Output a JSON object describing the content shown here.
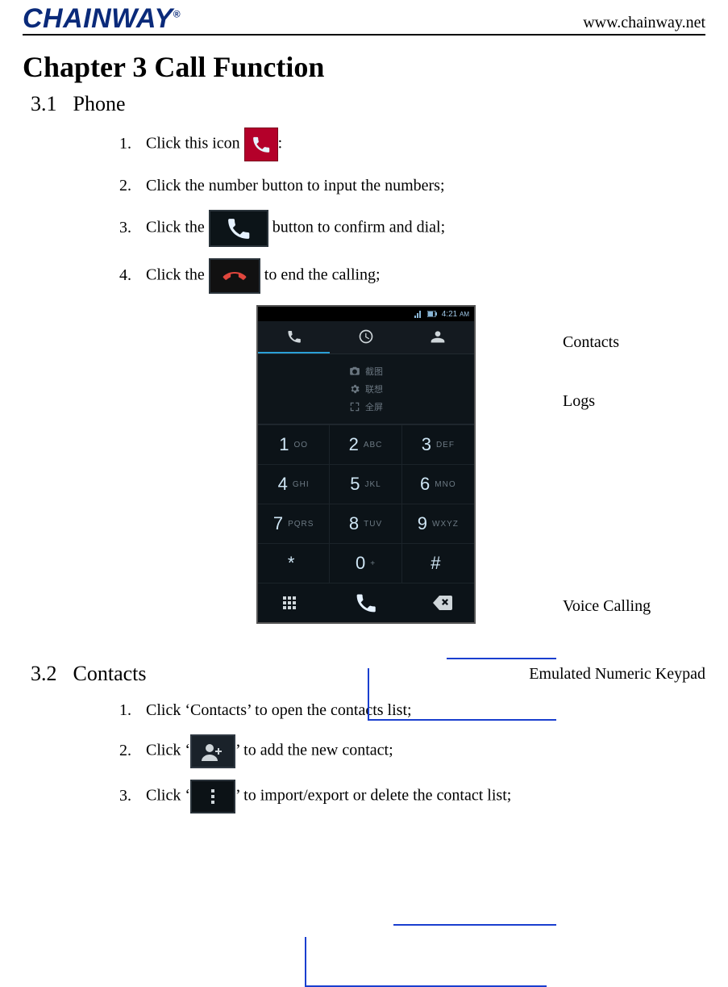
{
  "brand": "CHAINWAY",
  "brand_reg": "®",
  "url": "www.chainway.net",
  "chapter_title": "Chapter 3 Call Function",
  "section31": {
    "num": "3.1",
    "title": "Phone"
  },
  "section32": {
    "num": "3.2",
    "title": "Contacts"
  },
  "s31": {
    "i1a": "1.",
    "i1b": "Click this icon ",
    "i1c": ":",
    "i2a": "2.",
    "i2b": "Click the number button to input the numbers;",
    "i3a": "3.",
    "i3b_pre": "Click the ",
    "i3b_post": " button to confirm and dial;",
    "i4a": "4.",
    "i4b_pre": "Click the ",
    "i4b_post": " to end the calling;"
  },
  "s32": {
    "i1a": "1.",
    "i1b": "Click ‘Contacts’ to open the contacts list;",
    "i2a": "2.",
    "i2b_pre": "Click ‘",
    "i2b_post": "’ to add the new contact;",
    "i3a": "3.",
    "i3b_pre": "Click ‘",
    "i3b_post": "’ to import/export or delete the contact list;"
  },
  "callouts": {
    "contacts": "Contacts",
    "logs": "Logs",
    "voice": "Voice Calling",
    "keypad": "Emulated Numeric Keypad"
  },
  "phone": {
    "time": "4:21",
    "ampm": "AM",
    "display_line1": "截图",
    "display_line2": "联想",
    "display_line3": "全屏",
    "keys": [
      {
        "d": "1",
        "l": "OO"
      },
      {
        "d": "2",
        "l": "ABC"
      },
      {
        "d": "3",
        "l": "DEF"
      },
      {
        "d": "4",
        "l": "GHI"
      },
      {
        "d": "5",
        "l": "JKL"
      },
      {
        "d": "6",
        "l": "MNO"
      },
      {
        "d": "7",
        "l": "PQRS"
      },
      {
        "d": "8",
        "l": "TUV"
      },
      {
        "d": "9",
        "l": "WXYZ"
      },
      {
        "d": "*",
        "l": ""
      },
      {
        "d": "0",
        "l": "+"
      },
      {
        "d": "#",
        "l": ""
      }
    ]
  }
}
